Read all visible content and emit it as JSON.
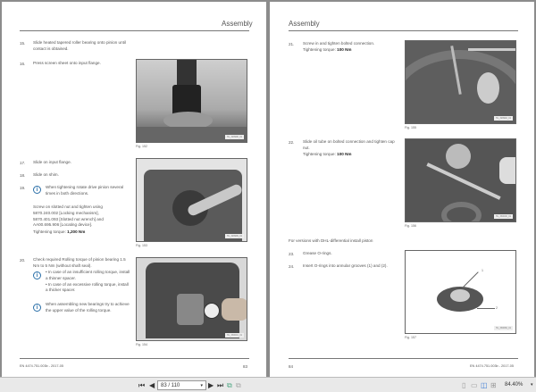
{
  "left_page": {
    "header": "Assembly",
    "steps": [
      {
        "num": "15.",
        "text": "Slide heated tapered roller bearing onto pinion until contact is obtained."
      },
      {
        "num": "16.",
        "text": "Press screen sheet onto input flange."
      },
      {
        "num": "17.",
        "text": "Slide on input flange."
      },
      {
        "num": "18.",
        "text": "Slide on shim."
      },
      {
        "num": "19.",
        "note": "When tightening rotate drive pinion several times in both directions.",
        "text": "Screw on slotted nut and tighten using 5870.240.002 [Locking mechanism], 5870.401.093 [Slotted nut wrench] and AA00.695.906 [Locating device].",
        "torque_label": "Tightening torque:",
        "torque": "1,200 Nm"
      },
      {
        "num": "20.",
        "text": "Check required Rolling torque of pinion bearing 1.5 Nm to 5 Nm (without shaft seal).",
        "bullets": [
          "In case of an insufficient rolling torque, install a thinner spacer.",
          "In case of an excessive rolling torque, install a thicker spacer."
        ],
        "note2": "When assembling new bearings try to achieve the upper value of the rolling torque."
      }
    ],
    "figs": [
      "Fig. 152",
      "Fig. 153",
      "Fig. 154"
    ],
    "footer_left": "EN 4474.751.003b - 2017-05",
    "page_number": "83"
  },
  "right_page": {
    "header": "Assembly",
    "steps": [
      {
        "num": "21.",
        "text": "Screw in and tighten bolted connection.",
        "torque_label": "Tightening torque:",
        "torque": "100 Nm"
      },
      {
        "num": "22.",
        "text": "Slide oil tube on bolted connection and tighten cap nut.",
        "torque_label": "Tightening torque:",
        "torque": "100 Nm"
      },
      {
        "num": "23.",
        "text": "Grease O-rings."
      },
      {
        "num": "24.",
        "text": "Insert O-rings into annular grooves (1) and (2)."
      }
    ],
    "section_note": "For versions with DHL-differential install piston",
    "figs": [
      "Fig. 155",
      "Fig. 156",
      "Fig. 157"
    ],
    "callouts": [
      "1",
      "2"
    ],
    "footer_right": "EN 4474.751.003b - 2017-05",
    "page_number": "84"
  },
  "toolbar": {
    "page_input": "83 / 110",
    "zoom": "84.40%"
  }
}
